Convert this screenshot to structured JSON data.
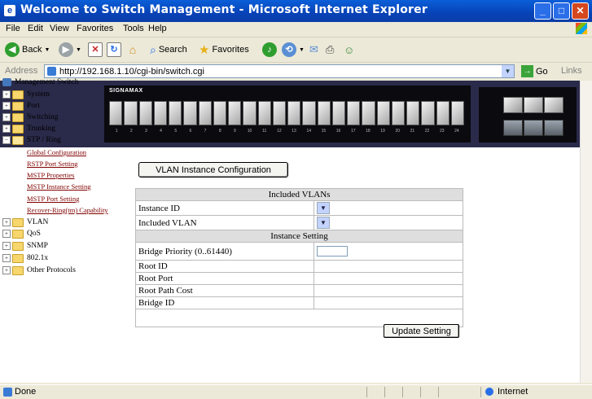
{
  "window": {
    "title": "Welcome to Switch Management - Microsoft Internet Explorer"
  },
  "menu": [
    "File",
    "Edit",
    "View",
    "Favorites",
    "Tools",
    "Help"
  ],
  "toolbar": {
    "back": "Back",
    "search": "Search",
    "favorites": "Favorites"
  },
  "address": {
    "label": "Address",
    "url": "http://192.168.1.10/cgi-bin/switch.cgi",
    "go": "Go",
    "links": "Links"
  },
  "device": {
    "brand": "SIGNAMAX",
    "ports": [
      "1",
      "2",
      "3",
      "4",
      "5",
      "6",
      "7",
      "8",
      "9",
      "10",
      "11",
      "12",
      "13",
      "14",
      "15",
      "16",
      "17",
      "18",
      "19",
      "20",
      "21",
      "22",
      "23",
      "24"
    ]
  },
  "tree": {
    "root": "Management Switch",
    "items": [
      "System",
      "Port",
      "Switching",
      "Trunking",
      "STP / Ring"
    ],
    "stp_children": [
      "Global Configuration",
      "RSTP Port Setting",
      "MSTP Properties",
      "MSTP Instance Setting",
      "MSTP Port Setting",
      "Recover-Ring(tm) Capability"
    ],
    "items_after": [
      "VLAN",
      "QoS",
      "SNMP",
      "802.1x",
      "Other Protocols"
    ]
  },
  "main": {
    "vlan_button": "VLAN Instance Configuration",
    "included_header": "Included VLANs",
    "instance_id_label": "Instance ID",
    "included_vlan_label": "Included VLAN",
    "instance_header": "Instance Setting",
    "bridge_priority_label": "Bridge Priority (0..61440)",
    "root_id_label": "Root ID",
    "root_port_label": "Root Port",
    "root_path_cost_label": "Root Path Cost",
    "bridge_id_label": "Bridge ID",
    "update_button": "Update Setting"
  },
  "status": {
    "text": "Done",
    "zone": "Internet"
  }
}
